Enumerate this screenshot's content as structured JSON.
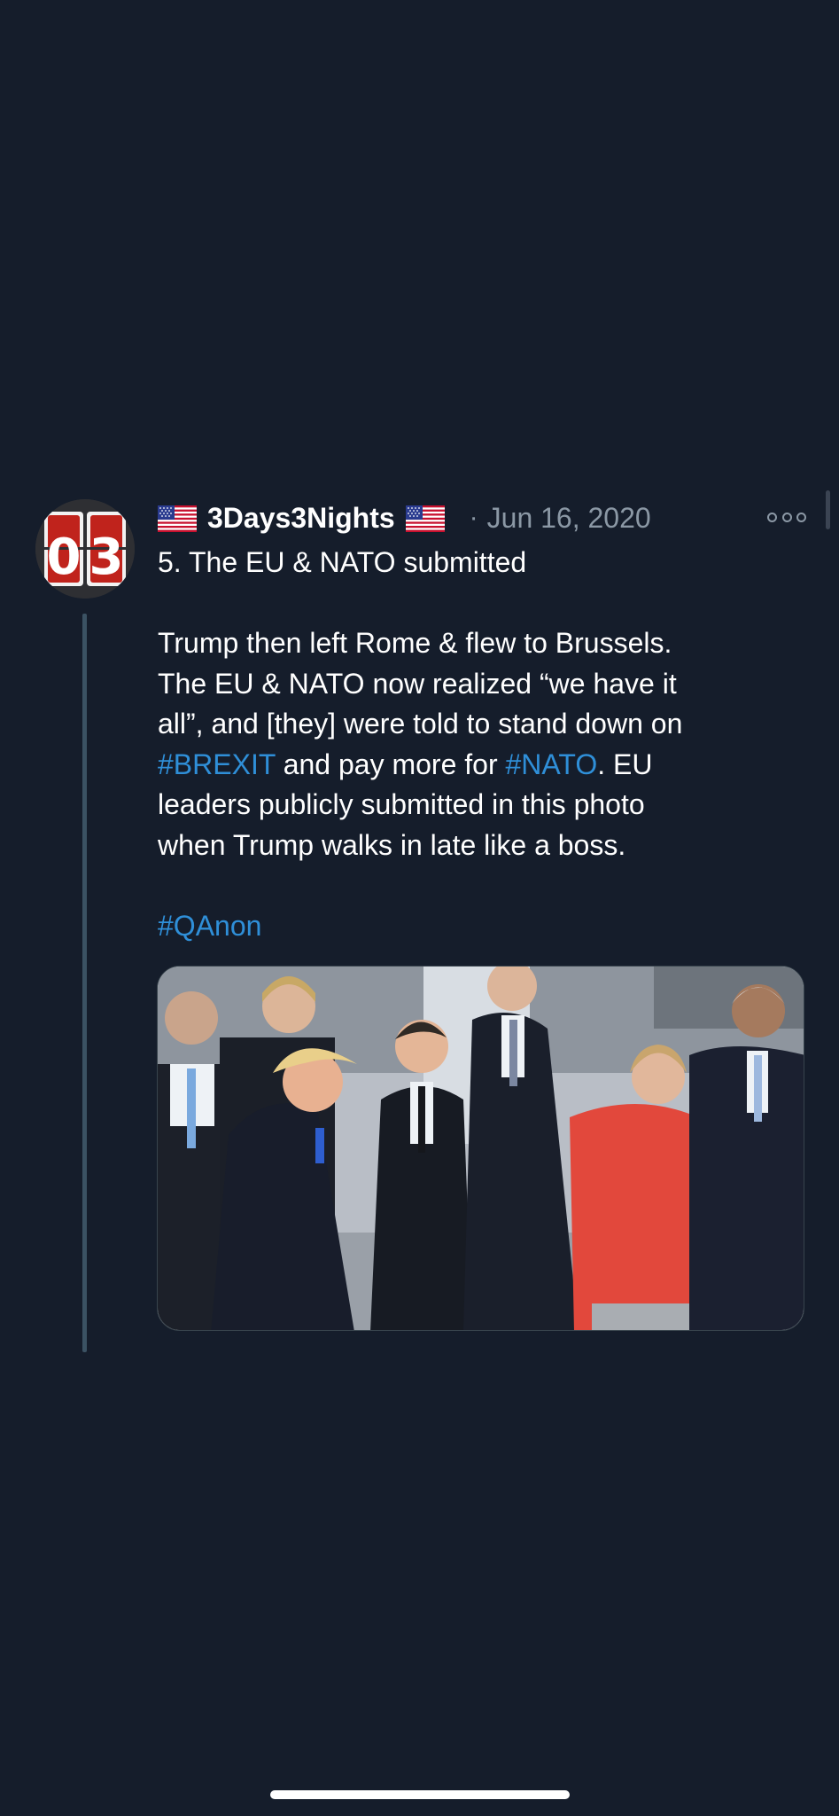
{
  "tweet": {
    "author": {
      "display_name": "3Days3Nights",
      "avatar_text": "03",
      "flag_icon": "us-flag-icon"
    },
    "separator": "·",
    "timestamp": "Jun 16, 2020",
    "more_icon": "more-options-icon",
    "title_line": "5. The EU & NATO submitted",
    "body_lines": {
      "line1": "Trump then left Rome & flew to Brussels.",
      "line2": "The EU & NATO now realized “we have it",
      "line3": "all”, and [they] were told to stand down on",
      "line4_hashtag1": "#BREXIT",
      "line4_mid": " and pay more for ",
      "line4_hashtag2": "#NATO",
      "line4_end": ". EU",
      "line5": "leaders publicly submitted in this photo",
      "line6": "when Trump walks in late like a boss."
    },
    "hashtag_line": "#QAnon",
    "media": {
      "type": "photo",
      "description_icon": "photo"
    }
  },
  "colors": {
    "background": "#151d2b",
    "hashtag": "#2f8fd8",
    "secondary_text": "#8b98a5",
    "thread_line": "#3b5263"
  }
}
